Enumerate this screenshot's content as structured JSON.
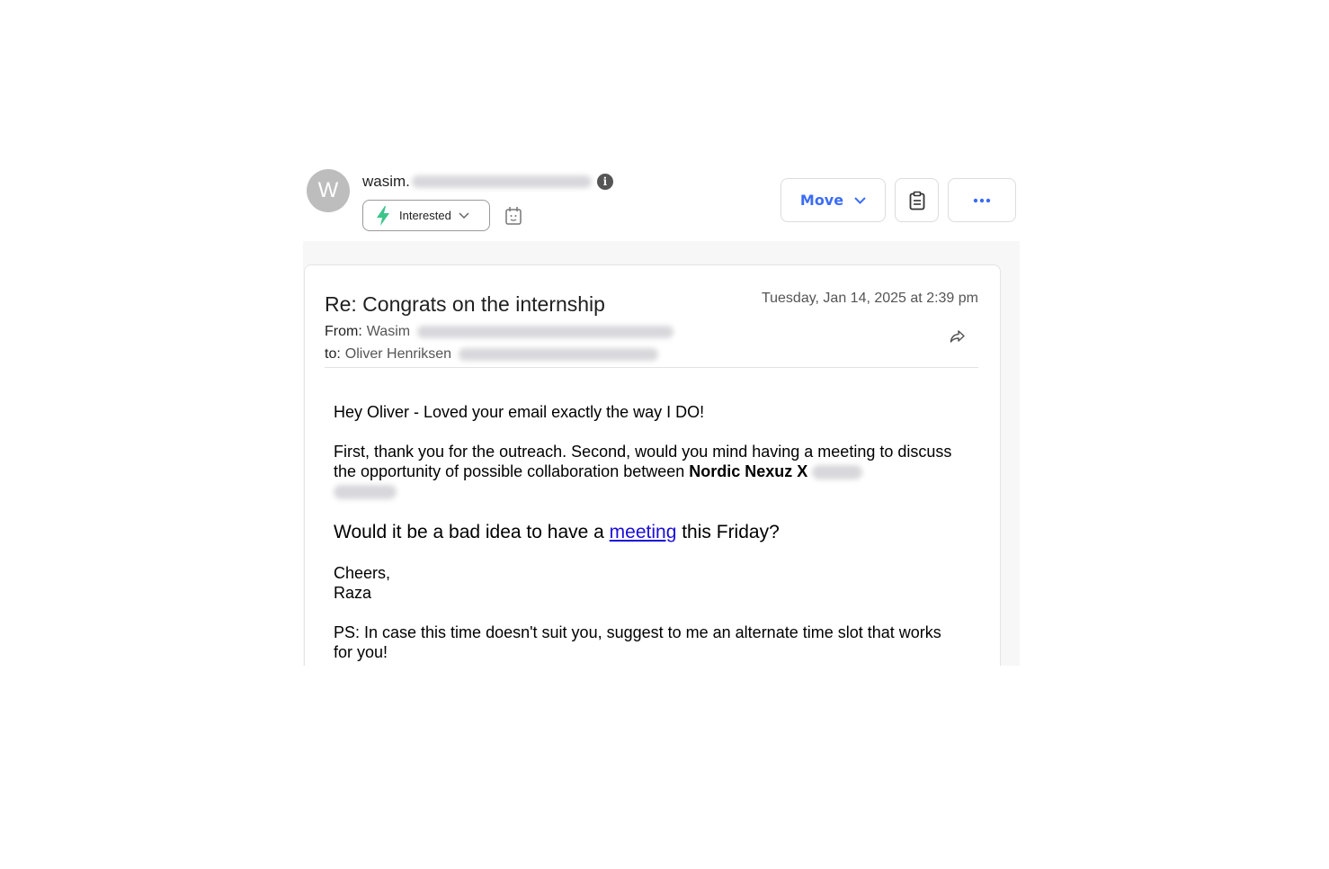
{
  "sender": {
    "avatar_letter": "W",
    "name": "wasim."
  },
  "status": {
    "label": "Interested",
    "color": "#3cc48a"
  },
  "toolbar": {
    "move_label": "Move",
    "accent_color": "#3b6cf5"
  },
  "email": {
    "subject": "Re: Congrats on the internship",
    "date": "Tuesday, Jan 14, 2025 at 2:39 pm",
    "from_label": "From:",
    "from_name": "Wasim",
    "to_label": "to:",
    "to_name": "Oliver Henriksen",
    "greeting": "Hey Oliver - Loved your email exactly the way I DO!",
    "para2_text": "First, thank you for the outreach. Second, would you mind having a meeting to discuss the opportunity of possible collaboration between ",
    "para2_bold": "Nordic Nexuz X",
    "para3_before": "Would it be a bad idea to have a ",
    "para3_link": "meeting",
    "para3_after": " this Friday?",
    "closing": "Cheers,",
    "signature": "Raza",
    "ps": "PS: In case this time doesn't suit you, suggest to me an alternate time slot that works for you!"
  }
}
